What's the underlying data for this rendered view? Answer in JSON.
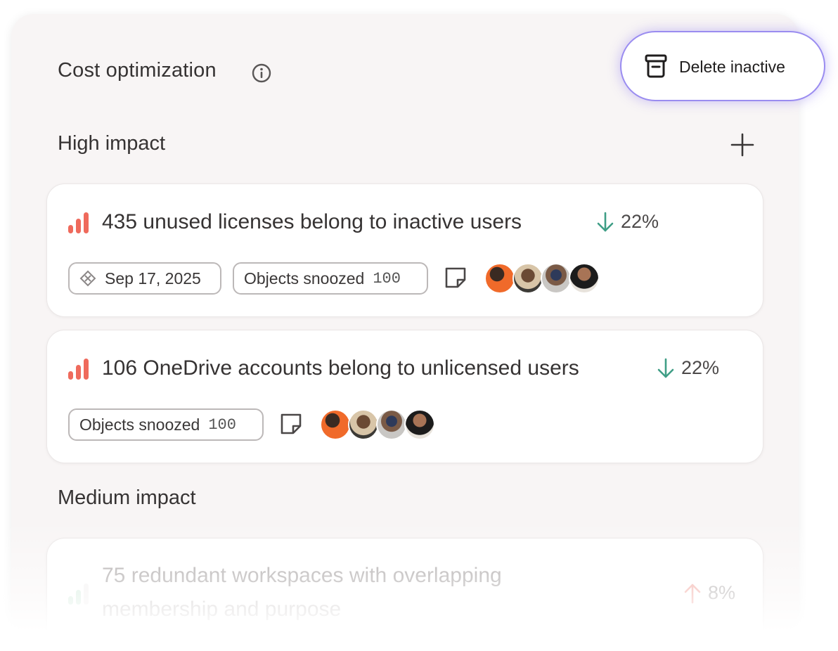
{
  "header": {
    "title": "Cost optimization",
    "info_icon": "info-icon",
    "delete_button": {
      "label": "Delete inactive",
      "icon": "trash-icon"
    }
  },
  "colors": {
    "bars_high": "#ef6a5c",
    "bars_medium": "#7fc79a",
    "trend_down": "#3f9e86",
    "trend_up": "#ef6a5c",
    "button_border": "#9a8cf0"
  },
  "sections": [
    {
      "title": "High impact",
      "add_icon": "plus-icon",
      "cards": [
        {
          "title": "435 unused licenses belong to inactive users",
          "trend": {
            "direction": "down",
            "value": "22%"
          },
          "date_chip": "Sep 17, 2025",
          "snooze_chip": {
            "label": "Objects snoozed",
            "count": "100"
          },
          "note_icon": "note-icon",
          "avatars": [
            "avatar-1",
            "avatar-2",
            "avatar-3",
            "avatar-4"
          ]
        },
        {
          "title": "106 OneDrive accounts belong to unlicensed users",
          "trend": {
            "direction": "down",
            "value": "22%"
          },
          "snooze_chip": {
            "label": "Objects snoozed",
            "count": "100"
          },
          "note_icon": "note-icon",
          "avatars": [
            "avatar-1",
            "avatar-2",
            "avatar-3",
            "avatar-4"
          ]
        }
      ]
    },
    {
      "title": "Medium impact",
      "cards": [
        {
          "title_line1": "75 redundant workspaces with overlapping",
          "title_line2": "membership and purpose",
          "trend": {
            "direction": "up",
            "value": "8%"
          }
        }
      ]
    }
  ]
}
